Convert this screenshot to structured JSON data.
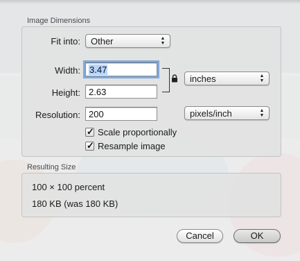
{
  "dimensions_group": {
    "title": "Image Dimensions",
    "fit_into_label": "Fit into:",
    "fit_into_value": "Other",
    "width_label": "Width:",
    "width_value": "3.47",
    "height_label": "Height:",
    "height_value": "2.63",
    "size_unit_value": "inches",
    "resolution_label": "Resolution:",
    "resolution_value": "200",
    "resolution_unit_value": "pixels/inch",
    "scale_label": "Scale proportionally",
    "scale_checked": true,
    "resample_label": "Resample image",
    "resample_checked": true
  },
  "result_group": {
    "title": "Resulting Size",
    "dimensions_text": "100 × 100 percent",
    "filesize_text": "180 KB (was 180 KB)"
  },
  "buttons": {
    "cancel": "Cancel",
    "ok": "OK"
  },
  "icons": {
    "lock": "lock-icon",
    "popup_arrows": "up-down-arrows-icon"
  }
}
